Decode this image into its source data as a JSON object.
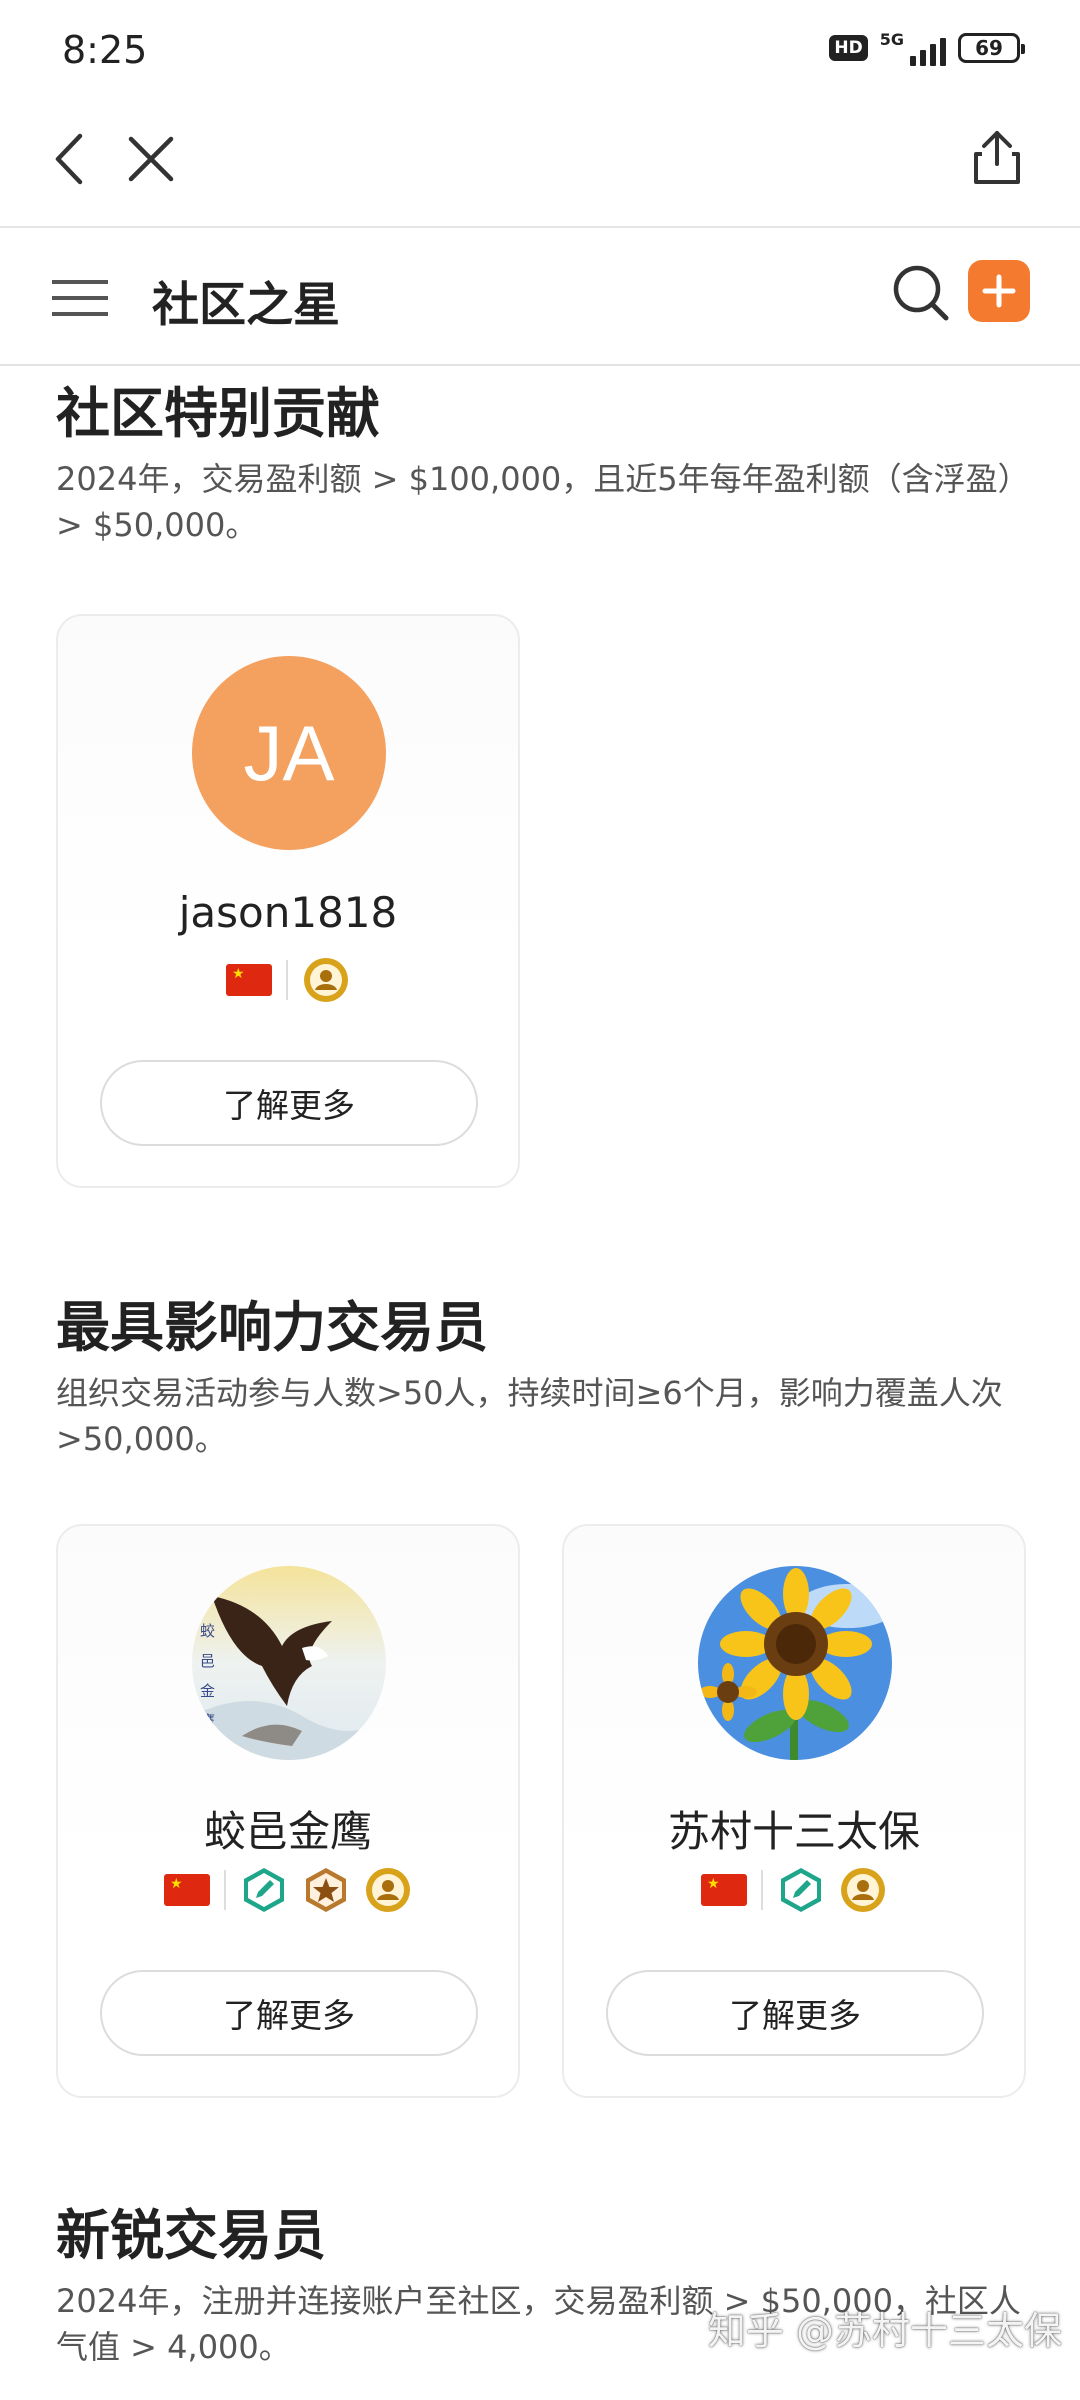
{
  "status_bar": {
    "time": "8:25",
    "hd": "HD",
    "network": "5G",
    "battery": "69"
  },
  "nav": {
    "back_icon": "chevron-left-icon",
    "close_icon": "close-icon",
    "share_icon": "share-icon"
  },
  "header": {
    "title": "社区之星",
    "menu_icon": "menu-icon",
    "search_icon": "search-icon",
    "add_icon": "plus-icon",
    "accent_color": "#f47a2f"
  },
  "sections": [
    {
      "title": "社区特别贡献",
      "description": "2024年，交易盈利额 > $100,000，且近5年每年盈利额（含浮盈）> $50,000。",
      "cards": [
        {
          "avatar_initials": "JA",
          "avatar_color": "#f4a160",
          "username": "jason1818",
          "badges": [
            "china-flag-icon",
            "user-medal-icon"
          ],
          "button": "了解更多"
        }
      ]
    },
    {
      "title": "最具影响力交易员",
      "description": "组织交易活动参与人数>50人，持续时间≥6个月，影响力覆盖人次>50,000。",
      "cards": [
        {
          "avatar_image": "eagle-avatar",
          "username": "蛟邑金鹰",
          "badges": [
            "china-flag-icon",
            "pencil-badge-icon",
            "star-medal-icon",
            "user-medal-icon"
          ],
          "button": "了解更多"
        },
        {
          "avatar_image": "sunflower-avatar",
          "username": "苏村十三太保",
          "badges": [
            "china-flag-icon",
            "pencil-badge-icon",
            "user-medal-icon"
          ],
          "button": "了解更多"
        }
      ]
    },
    {
      "title": "新锐交易员",
      "description": "2024年，注册并连接账户至社区，交易盈利额 > $50,000，社区人气值 > 4,000。"
    }
  ],
  "watermark": "知乎 @苏村十三太保"
}
